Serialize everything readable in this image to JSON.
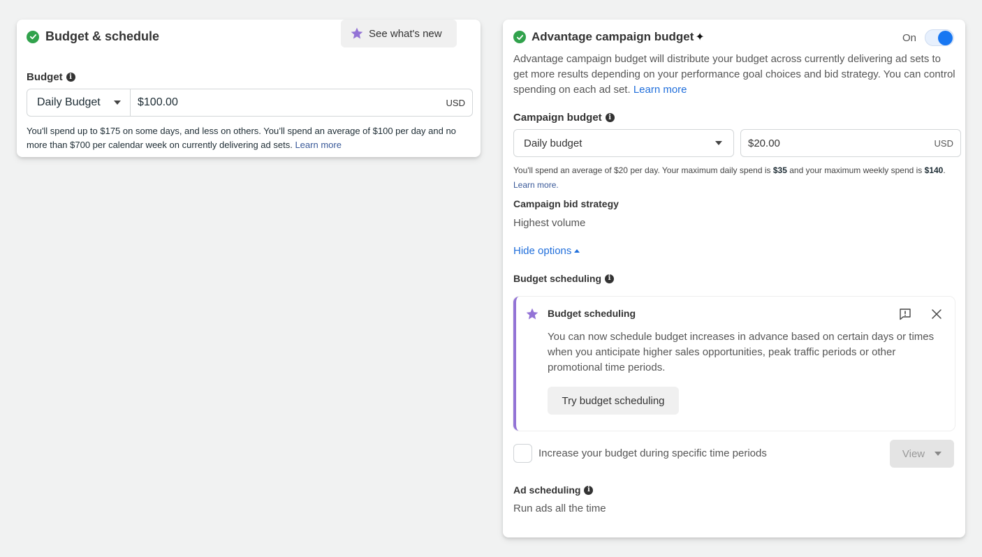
{
  "budget_schedule": {
    "title": "Budget & schedule",
    "whats_new_label": "See what's new",
    "budget_label": "Budget",
    "budget_type": "Daily Budget",
    "budget_amount": "$100.00",
    "currency": "USD",
    "help_text": "You'll spend up to $175 on some days, and less on others. You’ll spend an average of $100 per day and no more than $700 per calendar week on currently delivering ad sets.",
    "learn_more": "Learn more"
  },
  "advantage": {
    "title": "Advantage campaign budget",
    "sparkle": "✦",
    "toggle_label": "On",
    "toggle_on": true,
    "description": "Advantage campaign budget will distribute your budget across currently delivering ad sets to get more results depending on your performance goal choices and bid strategy. You can control spending on each ad set.",
    "learn_more": "Learn more",
    "campaign_budget_label": "Campaign budget",
    "budget_type": "Daily budget",
    "budget_amount": "$20.00",
    "currency": "USD",
    "help_prefix": "You'll spend an average of $20 per day. Your maximum daily spend is ",
    "help_max_daily": "$35",
    "help_mid": " and your maximum weekly spend is ",
    "help_max_weekly": "$140",
    "help_suffix": ". ",
    "help_learn_more": "Learn more.",
    "bid_strategy_label": "Campaign bid strategy",
    "bid_strategy_value": "Highest volume",
    "hide_options": "Hide options",
    "budget_scheduling_label": "Budget scheduling",
    "notice": {
      "title": "Budget scheduling",
      "body": "You can now schedule budget increases in advance based on certain days or times when you anticipate higher sales opportunities, peak traffic periods or other promotional time periods.",
      "button": "Try budget scheduling"
    },
    "increase_label": "Increase your budget during specific time periods",
    "increase_checked": false,
    "view_button": "View",
    "ad_scheduling_label": "Ad scheduling",
    "ad_scheduling_value": "Run ads all the time"
  },
  "colors": {
    "success": "#31a24c",
    "accent_blue": "#1877f2",
    "link": "#216fdb",
    "notice_accent": "#9373d6"
  }
}
